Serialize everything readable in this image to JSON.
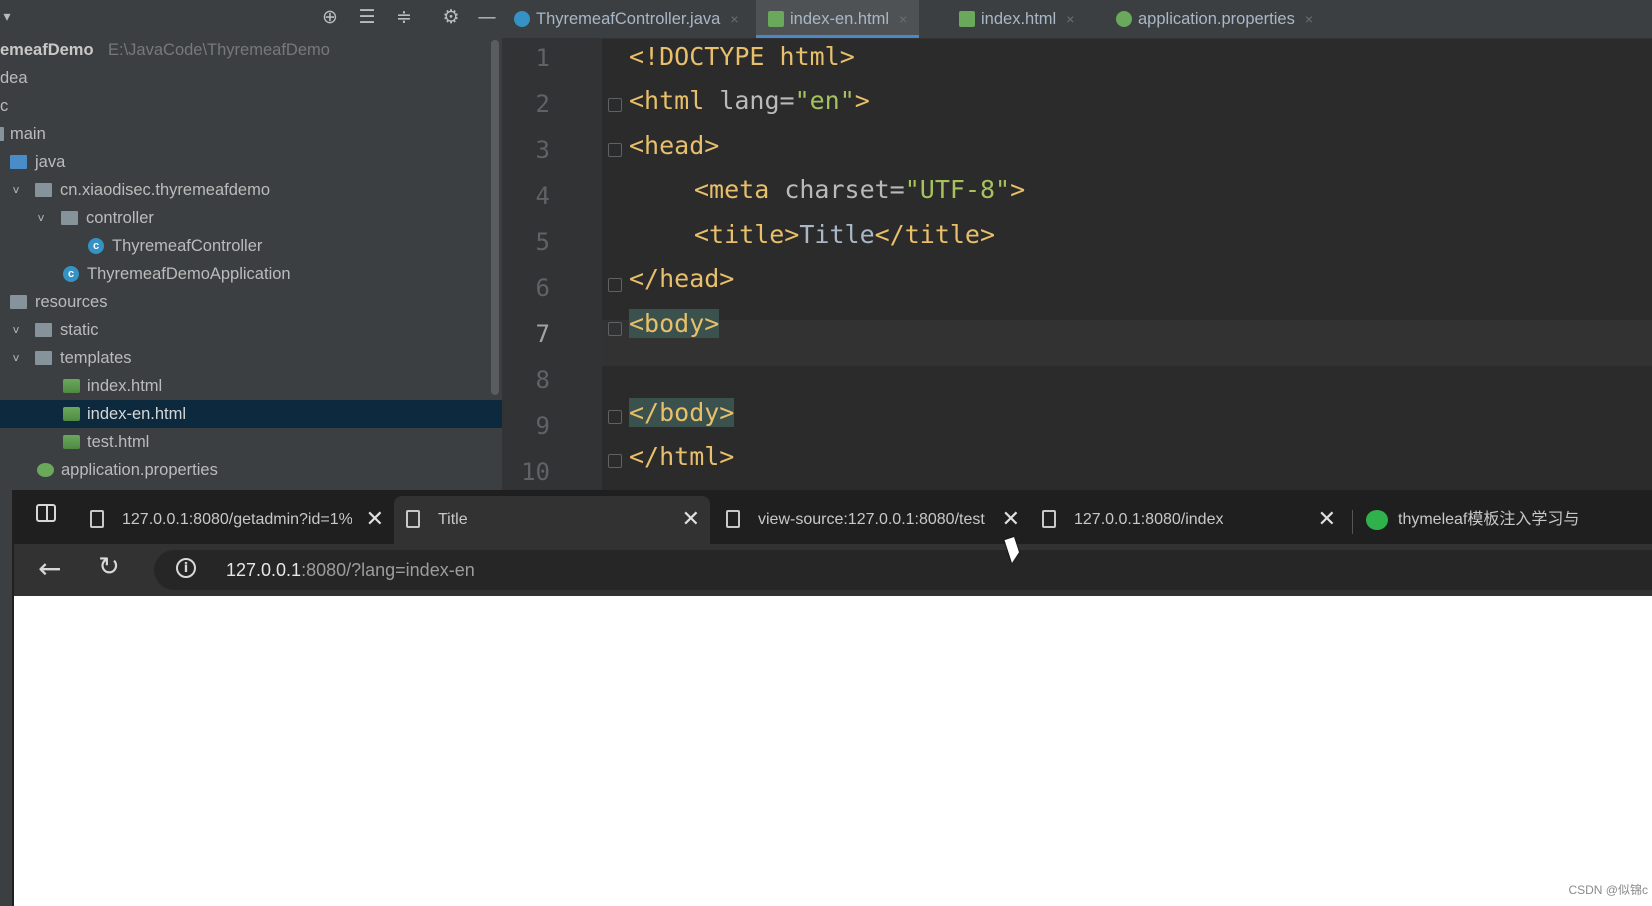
{
  "project": {
    "title": "emeafDemo",
    "path": "E:\\JavaCode\\ThyremeafDemo",
    "tree": [
      {
        "label": "dea",
        "kind": "plain"
      },
      {
        "label": "c",
        "kind": "plain"
      },
      {
        "label": "main",
        "kind": "plain"
      },
      {
        "label": "java",
        "kind": "folder-blue"
      },
      {
        "label": "cn.xiaodisec.thyremeafdemo",
        "kind": "package",
        "expanded": true
      },
      {
        "label": "controller",
        "kind": "folder",
        "expanded": true
      },
      {
        "label": "ThyremeafController",
        "kind": "class"
      },
      {
        "label": "ThyremeafDemoApplication",
        "kind": "class"
      },
      {
        "label": "resources",
        "kind": "folder"
      },
      {
        "label": "static",
        "kind": "folder",
        "expanded": true
      },
      {
        "label": "templates",
        "kind": "folder",
        "expanded": true
      },
      {
        "label": "index.html",
        "kind": "html"
      },
      {
        "label": "index-en.html",
        "kind": "html",
        "selected": true
      },
      {
        "label": "test.html",
        "kind": "html"
      },
      {
        "label": "application.properties",
        "kind": "properties"
      }
    ]
  },
  "editor": {
    "tabs": [
      {
        "label": "ThyremeafController.java",
        "icon": "class-icon"
      },
      {
        "label": "index-en.html",
        "icon": "html-file-icon",
        "active": true
      },
      {
        "label": "index.html",
        "icon": "html-file-icon"
      },
      {
        "label": "application.properties",
        "icon": "properties-file-icon"
      }
    ],
    "close_glyph": "×",
    "line_numbers": [
      "1",
      "2",
      "3",
      "4",
      "5",
      "6",
      "7",
      "8",
      "9",
      "10"
    ],
    "current_line": "7",
    "code": {
      "l1": "<!DOCTYPE html>",
      "l2_open": "<html ",
      "l2_attr": "lang=",
      "l2_val": "\"en\"",
      "l2_close": ">",
      "l3": "<head>",
      "l4_open": "<meta ",
      "l4_attr": "charset=",
      "l4_val": "\"UTF-8\"",
      "l4_close": ">",
      "l5_open": "<title>",
      "l5_text": "Title",
      "l5_close": "</title>",
      "l6": "</head>",
      "l7": "<body>",
      "l9": "</body>",
      "l10": "</html>"
    }
  },
  "browser": {
    "tabs": [
      {
        "label": "127.0.0.1:8080/getadmin?id=1%",
        "icon": "page-icon"
      },
      {
        "label": "Title",
        "icon": "page-icon",
        "active": true
      },
      {
        "label": "view-source:127.0.0.1:8080/test",
        "icon": "page-icon"
      },
      {
        "label": "127.0.0.1:8080/index",
        "icon": "page-icon"
      },
      {
        "label": "thymeleaf模板注入学习与",
        "icon": "wechat-icon"
      }
    ],
    "close_glyph": "✕",
    "url_host": "127.0.0.1",
    "url_rest": ":8080/?lang=index-en"
  },
  "watermark": "CSDN @似锦c"
}
